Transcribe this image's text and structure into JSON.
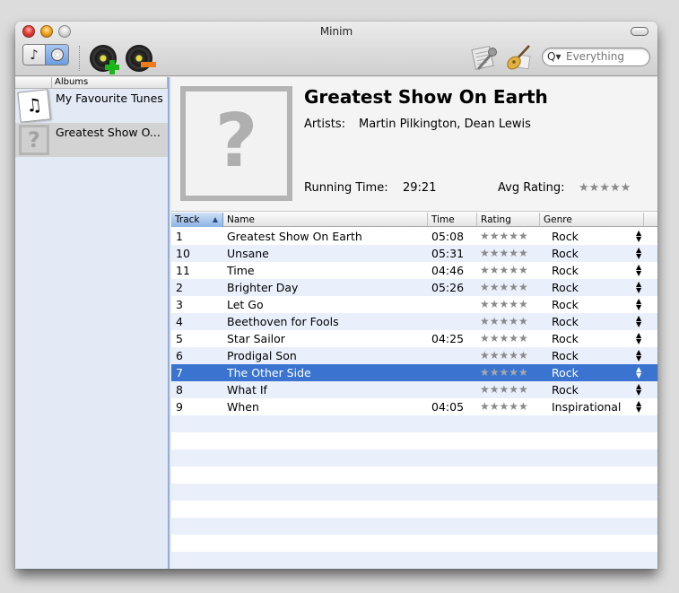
{
  "window": {
    "title": "Minim"
  },
  "toolbar": {
    "view_segment": {
      "left_icon": "music-note-icon",
      "right_icon": "cd-icon",
      "selected": "right"
    },
    "add_album_icon": "add-record-icon",
    "remove_album_icon": "remove-record-icon",
    "artist_icon": "microphone-lyrics-icon",
    "genre_icon": "guitar-icon",
    "search": {
      "icon": "search-icon",
      "placeholder": "Everything",
      "value": ""
    },
    "glyphs": {
      "note": "♪",
      "magnifier": "Q▾"
    }
  },
  "sidebar": {
    "header": "Albums",
    "albums": [
      {
        "name": "My Favourite Tunes",
        "thumb": "sheet-music",
        "selected": false
      },
      {
        "name": "Greatest Show O...",
        "thumb": "unknown",
        "selected": true
      }
    ],
    "q_glyph": "?",
    "note_glyph": "♫"
  },
  "album_info": {
    "art_placeholder": "?",
    "title": "Greatest Show On Earth",
    "artists_label": "Artists:",
    "artists": "Martin Pilkington, Dean Lewis",
    "running_time_label": "Running Time:",
    "running_time": "29:21",
    "avg_rating_label": "Avg Rating:",
    "avg_rating": 0,
    "avg_rating_stars": "★★★★★"
  },
  "tracks_table": {
    "columns": {
      "track": "Track",
      "name": "Name",
      "time": "Time",
      "rating": "Rating",
      "genre": "Genre"
    },
    "sort": {
      "column": "track",
      "direction": "ascending",
      "arrow": "▲"
    },
    "stepper_glyph": "▲\n▼",
    "rows": [
      {
        "track": "1",
        "name": "Greatest Show On Earth",
        "time": "05:08",
        "rating": 0,
        "stars": "★★★★★",
        "genre": "Rock"
      },
      {
        "track": "10",
        "name": "Unsane",
        "time": "05:31",
        "rating": 0,
        "stars": "★★★★★",
        "genre": "Rock"
      },
      {
        "track": "11",
        "name": "Time",
        "time": "04:46",
        "rating": 0,
        "stars": "★★★★★",
        "genre": "Rock"
      },
      {
        "track": "2",
        "name": "Brighter Day",
        "time": "05:26",
        "rating": 0,
        "stars": "★★★★★",
        "genre": "Rock"
      },
      {
        "track": "3",
        "name": "Let Go",
        "time": "",
        "rating": 0,
        "stars": "★★★★★",
        "genre": "Rock"
      },
      {
        "track": "4",
        "name": "Beethoven for Fools",
        "time": "",
        "rating": 0,
        "stars": "★★★★★",
        "genre": "Rock"
      },
      {
        "track": "5",
        "name": "Star Sailor",
        "time": "04:25",
        "rating": 0,
        "stars": "★★★★★",
        "genre": "Rock"
      },
      {
        "track": "6",
        "name": "Prodigal Son",
        "time": "",
        "rating": 0,
        "stars": "★★★★★",
        "genre": "Rock"
      },
      {
        "track": "7",
        "name": "The Other Side",
        "time": "",
        "rating": 0,
        "stars": "★★★★★",
        "genre": "Rock",
        "selected": true
      },
      {
        "track": "8",
        "name": "What If",
        "time": "",
        "rating": 0,
        "stars": "★★★★★",
        "genre": "Rock"
      },
      {
        "track": "9",
        "name": "When",
        "time": "04:05",
        "rating": 0,
        "stars": "★★★★★",
        "genre": "Inspirational"
      }
    ]
  },
  "colors": {
    "selection": "#3a73d0",
    "alt_row": "#eaf0fb",
    "sidebar_bg": "#e3eaf5",
    "star_empty": "#8a8a8a"
  }
}
